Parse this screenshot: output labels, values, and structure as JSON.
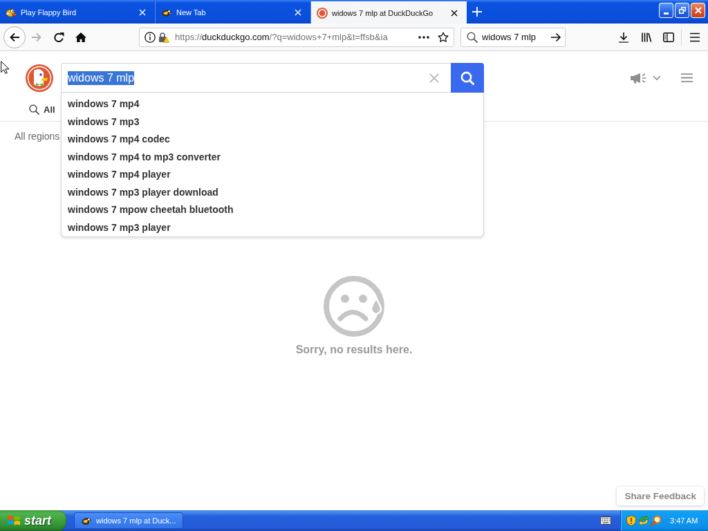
{
  "tabs": [
    {
      "kind": "game",
      "title": "Play Flappy Bird",
      "selected": false
    },
    {
      "kind": "newtab",
      "title": "New Tab",
      "selected": false
    },
    {
      "kind": "search",
      "title": "widows 7 mlp at DuckDuckGo",
      "selected": true
    }
  ],
  "toolbar": {
    "forward_disabled": true,
    "url": {
      "scheme": "https://",
      "host": "duckduckgo.com",
      "rest": "/?q=widows+7+mlp&t=ffsb&ia"
    },
    "search_value": "widows 7 mlp"
  },
  "page": {
    "query": "widows 7 mlp",
    "query_selected": true,
    "suggestions": [
      "windows 7 mp4",
      "windows 7 mp3",
      "windows 7 mp4 codec",
      "windows 7 mp4 to mp3 converter",
      "windows 7 mp4 player",
      "windows 7 mp3 player download",
      "windows 7 mpow cheetah bluetooth",
      "windows 7 mp3 player"
    ],
    "verticals": [
      {
        "label": "All"
      }
    ],
    "region": "All regions",
    "empty_message": "Sorry, no results here.",
    "feedback_button": "Share Feedback"
  },
  "taskbar": {
    "start": "start",
    "tasks": [
      {
        "title": "widows 7 mlp at Duck..."
      }
    ],
    "clock": "3:47 AM"
  }
}
